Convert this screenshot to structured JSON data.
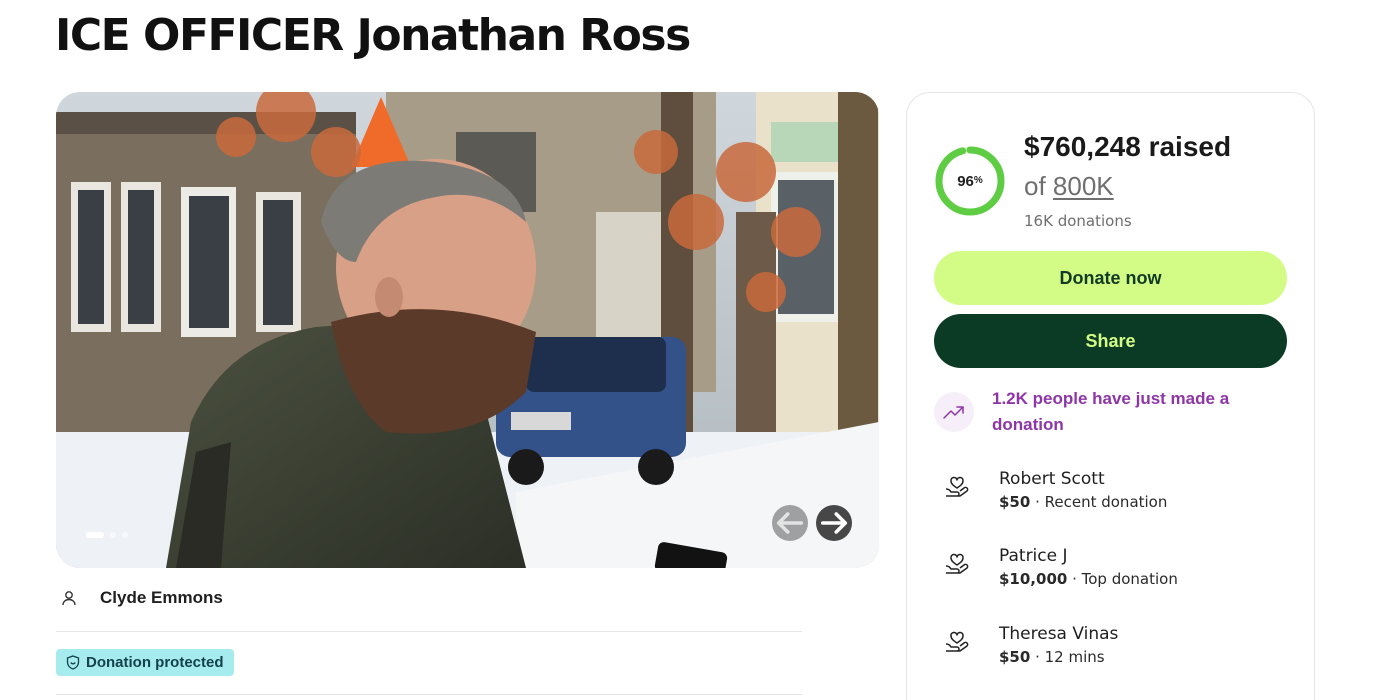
{
  "campaign": {
    "title": "ICE OFFICER Jonathan Ross",
    "organizer": "Clyde Emmons",
    "badge": "Donation protected"
  },
  "photo": {
    "dots": 3,
    "active_dot": 0,
    "prev_icon": "arrow-left-icon",
    "next_icon": "arrow-right-icon"
  },
  "stats": {
    "percent_label": "96",
    "percent_suffix": "%",
    "percent_value": 0.96,
    "raised": "$760,248 raised",
    "goal_prefix": "of ",
    "goal": "800K",
    "donations": "16K donations"
  },
  "actions": {
    "donate": "Donate now",
    "share": "Share"
  },
  "trend": {
    "text": "1.2K people have just made a donation",
    "icon": "trending-up-icon"
  },
  "donors": [
    {
      "name": "Robert Scott",
      "amount": "$50",
      "sep": " · ",
      "note": "Recent donation"
    },
    {
      "name": "Patrice J",
      "amount": "$10,000",
      "sep": " · ",
      "note": "Top donation"
    },
    {
      "name": "Theresa Vinas",
      "amount": "$50",
      "sep": " · ",
      "note": "12 mins"
    }
  ],
  "colors": {
    "donate_bg": "#d3fc86",
    "share_bg": "#0c3b25",
    "progress": "#5fcd44",
    "trend_text": "#8e36a8",
    "badge_bg": "#a6ecee"
  }
}
